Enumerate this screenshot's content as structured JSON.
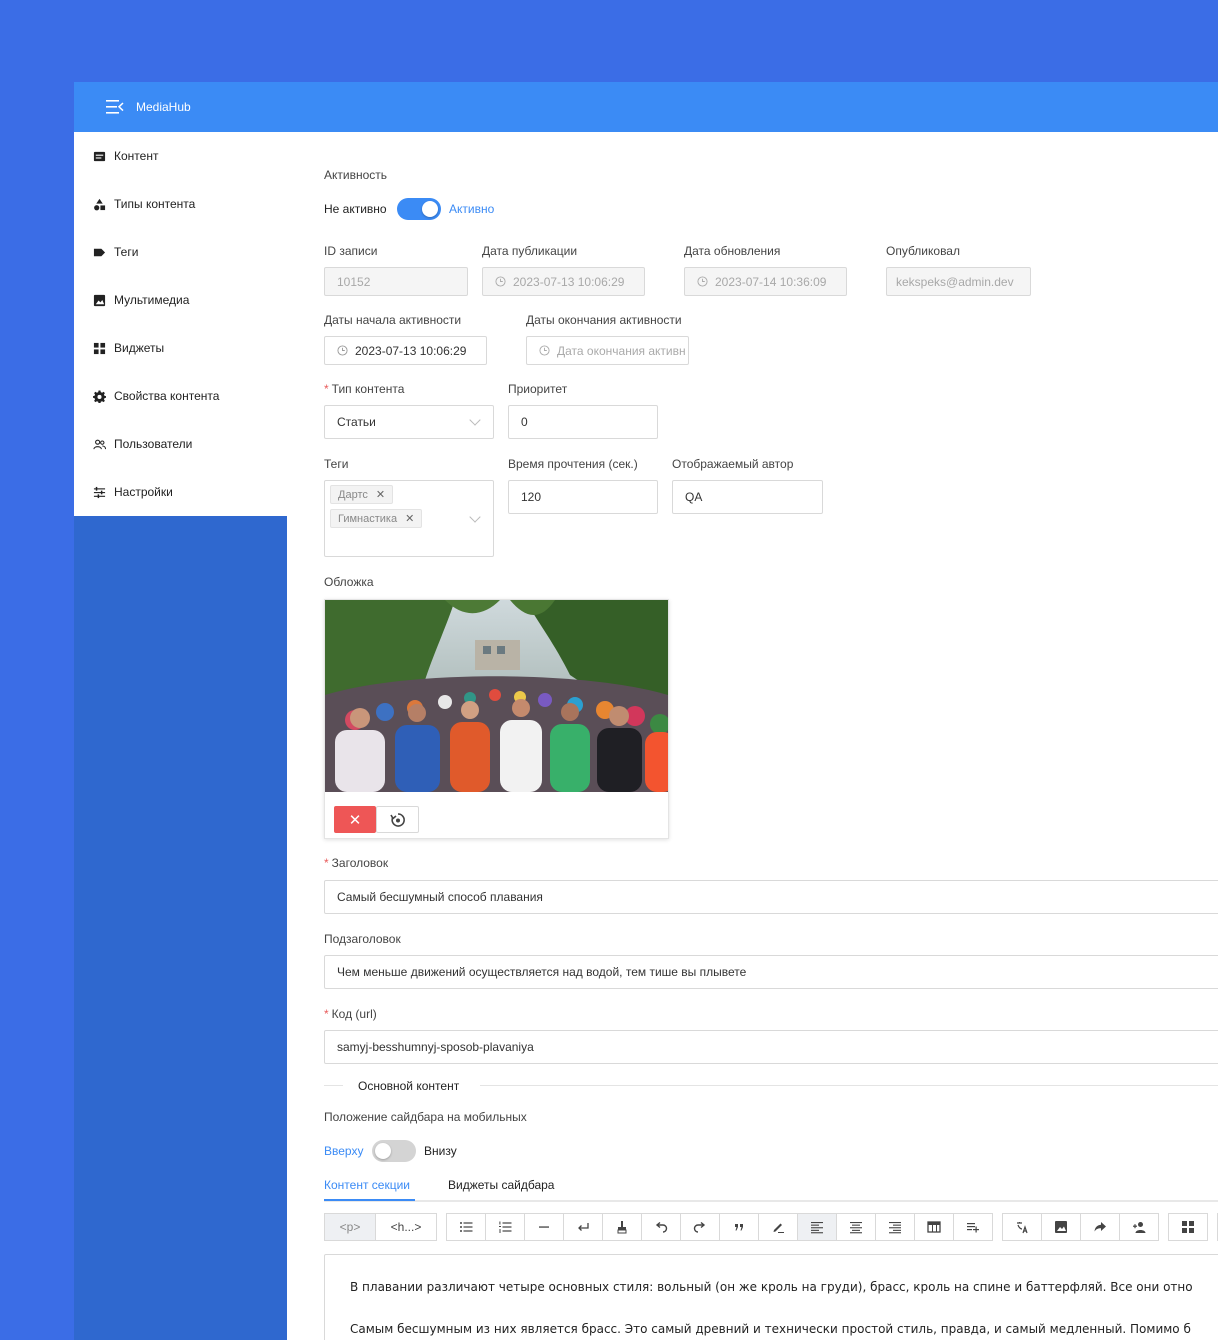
{
  "app": {
    "title": "MediaHub"
  },
  "sidebar": {
    "items": [
      {
        "label": "Контент",
        "icon": "content-icon"
      },
      {
        "label": "Типы контента",
        "icon": "shapes-icon"
      },
      {
        "label": "Теги",
        "icon": "tag-icon"
      },
      {
        "label": "Мультимедиа",
        "icon": "image-icon"
      },
      {
        "label": "Виджеты",
        "icon": "widgets-icon"
      },
      {
        "label": "Свойства контента",
        "icon": "gear-icon"
      },
      {
        "label": "Пользователи",
        "icon": "users-icon"
      },
      {
        "label": "Настройки",
        "icon": "sliders-icon"
      }
    ]
  },
  "form": {
    "activity": {
      "label": "Активность",
      "off_label": "Не активно",
      "on_label": "Активно",
      "value": true
    },
    "record_id": {
      "label": "ID записи",
      "value": "10152"
    },
    "published_at": {
      "label": "Дата публикации",
      "value": "2023-07-13 10:06:29"
    },
    "updated_at": {
      "label": "Дата обновления",
      "value": "2023-07-14 10:36:09"
    },
    "published_by": {
      "label": "Опубликовал",
      "value": "kekspeks@admin.dev"
    },
    "active_from": {
      "label": "Даты начала активности",
      "value": "2023-07-13 10:06:29"
    },
    "active_to": {
      "label": "Даты окончания активности",
      "placeholder": "Дата окончания активн"
    },
    "content_type": {
      "label": "Тип контента",
      "value": "Статьи"
    },
    "priority": {
      "label": "Приоритет",
      "value": "0"
    },
    "tags": {
      "label": "Теги",
      "values": [
        "Дартс",
        "Гимнастика"
      ]
    },
    "read_time": {
      "label": "Время прочтения (сек.)",
      "value": "120"
    },
    "display_author": {
      "label": "Отображаемый автор",
      "value": "QA"
    },
    "cover": {
      "label": "Обложка",
      "delete_icon": "close-icon",
      "rotate_icon": "rotate-icon"
    },
    "title": {
      "label": "Заголовок",
      "value": "Самый бесшумный способ плавания"
    },
    "subtitle": {
      "label": "Подзаголовок",
      "value": "Чем меньше движений осуществляется над водой, тем тише вы плывете"
    },
    "slug": {
      "label": "Код (url)",
      "value": "samyj-besshumnyj-sposob-plavaniya"
    },
    "main_content_divider": "Основной контент",
    "sidebar_position": {
      "label": "Положение сайдбара на мобильных",
      "top_label": "Вверху",
      "bottom_label": "Внизу",
      "value": "top"
    },
    "tabs": [
      "Контент секции",
      "Виджеты сайдбара"
    ],
    "toolbar": {
      "p": "<p>",
      "h": "<h...>"
    },
    "editor": {
      "line1": "В плавании различают четыре основных стиля: вольный (он же кроль на груди), брасс, кроль на спине и баттерфляй. Все они отно",
      "line2": "Самым бесшумным из них является брасс. Это самый древний и технически простой стиль, правда, и самый медленный. Помимо б"
    }
  },
  "colors": {
    "accent": "#3b8bf5",
    "background": "#3b6de6",
    "sidebar_fill": "#2f68cf",
    "danger": "#ee5656"
  }
}
